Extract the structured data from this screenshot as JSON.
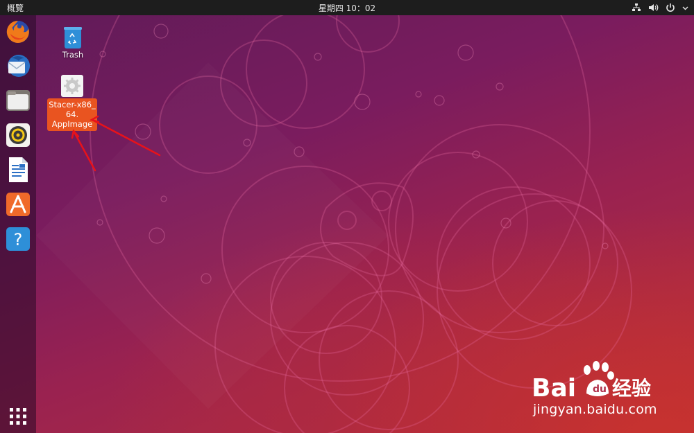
{
  "top_bar": {
    "activities_label": "概覽",
    "clock": "星期四 10：02",
    "status_icons": [
      "network-icon",
      "volume-icon",
      "power-icon",
      "chevron-down-icon"
    ]
  },
  "dock": {
    "items": [
      {
        "name": "firefox",
        "icon": "firefox-icon"
      },
      {
        "name": "thunderbird",
        "icon": "thunderbird-icon"
      },
      {
        "name": "files",
        "icon": "files-icon"
      },
      {
        "name": "rhythmbox",
        "icon": "rhythmbox-icon"
      },
      {
        "name": "libreoffice-writer",
        "icon": "writer-icon"
      },
      {
        "name": "software",
        "icon": "software-icon"
      },
      {
        "name": "help",
        "icon": "help-icon"
      }
    ],
    "show_apps_icon": "grid-icon",
    "help_glyph": "?"
  },
  "desktop": {
    "trash": {
      "label": "Trash",
      "icon": "trash-icon"
    },
    "stacer": {
      "label_lines": [
        "Stacer-x86_",
        "64.",
        "AppImage"
      ],
      "icon": "gear-icon",
      "selected": true
    }
  },
  "watermark": {
    "brand": "Bai",
    "brand_cn": "经验",
    "url": "jingyan.baidu.com"
  },
  "colors": {
    "accent": "#e95420",
    "top_bar": "#1d1d1d",
    "arrow": "#e8121a"
  }
}
